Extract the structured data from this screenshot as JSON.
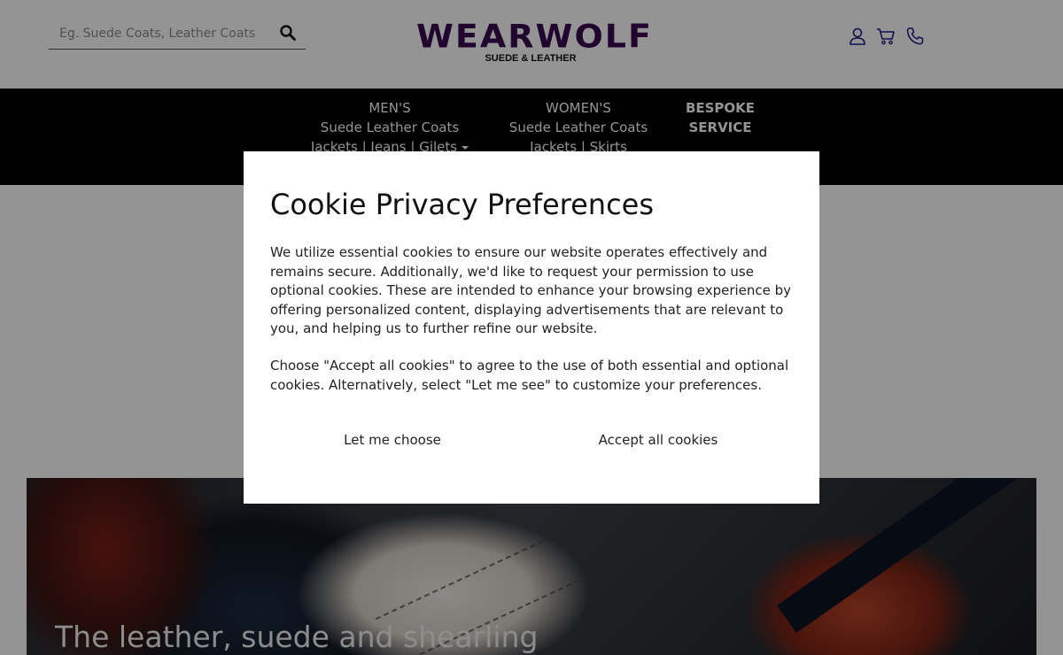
{
  "header": {
    "search": {
      "placeholder": "Eg. Suede Coats, Leather Coats",
      "value": ""
    },
    "logo": {
      "wordmark": "WEARWOLF",
      "tagline": "SUEDE & LEATHER"
    },
    "icons": [
      "user-icon",
      "cart-icon",
      "phone-icon"
    ],
    "icon_color": "#1b1b8a"
  },
  "nav": {
    "mens": {
      "title": "MEN'S",
      "line1": "Suede Leather Coats",
      "line2": "Jackets | Jeans | Gilets"
    },
    "womens": {
      "title": "WOMEN'S",
      "line1": "Suede Leather Coats",
      "line2": "Jackets | Skirts"
    },
    "bespoke": {
      "line1": "BESPOKE",
      "line2": "SERVICE"
    }
  },
  "hero": {
    "title": "The leather, suede and shearling"
  },
  "cookie_modal": {
    "title": "Cookie Privacy Preferences",
    "paragraph1": "We utilize essential cookies to ensure our website operates effectively and remains secure. Additionally, we'd like to request your permission to use optional cookies. These are intended to enhance your browsing experience by offering personalized content, displaying advertisements that are relevant to you, and helping us to further refine our website.",
    "paragraph2": "Choose \"Accept all cookies\" to agree to the use of both essential and optional cookies. Alternatively, select \"Let me see\" to customize your preferences.",
    "choose_label": "Let me choose",
    "accept_label": "Accept all cookies"
  },
  "colors": {
    "brand": "#3a0a52",
    "nav_bg": "#000000",
    "overlay": "rgba(0,0,0,0.42)"
  }
}
